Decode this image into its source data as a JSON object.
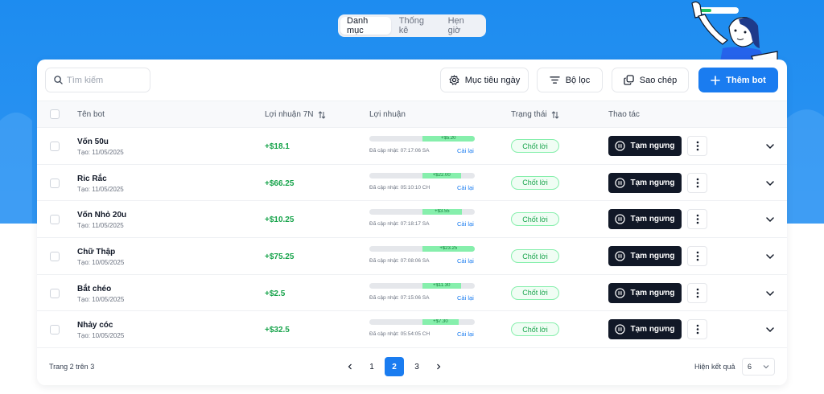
{
  "nav": {
    "tabs": [
      {
        "label": "Danh mục",
        "active": true
      },
      {
        "label": "Thống kê",
        "active": false
      },
      {
        "label": "Hẹn giờ",
        "active": false
      }
    ]
  },
  "toolbar": {
    "search_placeholder": "Tìm kiếm",
    "daily_target_label": "Mục tiêu ngày",
    "filter_label": "Bộ lọc",
    "copy_label": "Sao chép",
    "add_bot_label": "Thêm bot"
  },
  "table": {
    "columns": {
      "name": "Tên bot",
      "profit7": "Lợi nhuận 7N",
      "profit": "Lợi nhuận",
      "status": "Trạng thái",
      "actions": "Thao tác"
    },
    "rows": [
      {
        "name": "Vốn 50u",
        "created": "Tạo: 11/05/2025",
        "profit7": "+$18.1",
        "bar_label": "+$5.20",
        "bar_start": 0.5,
        "bar_end": 1.0,
        "updated": "Đã cập nhật: 07:17:06 SA",
        "reset": "Cài lại",
        "status": "Chốt lời",
        "pause": "Tạm ngưng"
      },
      {
        "name": "Ric Rắc",
        "created": "Tạo: 11/05/2025",
        "profit7": "+$66.25",
        "bar_label": "+$22.00",
        "bar_start": 0.5,
        "bar_end": 0.87,
        "updated": "Đã cập nhật: 05:10:10 CH",
        "reset": "Cài lại",
        "status": "Chốt lời",
        "pause": "Tạm ngưng"
      },
      {
        "name": "Vốn Nhỏ 20u",
        "created": "Tạo: 11/05/2025",
        "profit7": "+$10.25",
        "bar_label": "+$3.55",
        "bar_start": 0.5,
        "bar_end": 0.88,
        "updated": "Đã cập nhật: 07:18:17 SA",
        "reset": "Cài lại",
        "status": "Chốt lời",
        "pause": "Tạm ngưng"
      },
      {
        "name": "Chữ Thập",
        "created": "Tạo: 10/05/2025",
        "profit7": "+$75.25",
        "bar_label": "+$23.25",
        "bar_start": 0.5,
        "bar_end": 1.0,
        "updated": "Đã cập nhật: 07:08:06 SA",
        "reset": "Cài lại",
        "status": "Chốt lời",
        "pause": "Tạm ngưng"
      },
      {
        "name": "Bắt chéo",
        "created": "Tạo: 10/05/2025",
        "profit7": "+$2.5",
        "bar_label": "+$11.30",
        "bar_start": 0.5,
        "bar_end": 0.87,
        "updated": "Đã cập nhật: 07:15:06 SA",
        "reset": "Cài lại",
        "status": "Chốt lời",
        "pause": "Tạm ngưng"
      },
      {
        "name": "Nhảy cóc",
        "created": "Tạo: 10/05/2025",
        "profit7": "+$32.5",
        "bar_label": "+$7.30",
        "bar_start": 0.5,
        "bar_end": 0.85,
        "updated": "Đã cập nhật: 05:54:05 CH",
        "reset": "Cài lại",
        "status": "Chốt lời",
        "pause": "Tạm ngưng"
      }
    ]
  },
  "pagination": {
    "info": "Trang 2 trên 3",
    "pages": [
      "1",
      "2",
      "3"
    ],
    "current": "2",
    "per_page_label": "Hiện kết quả",
    "per_page_value": "6"
  },
  "colors": {
    "primary": "#1a7cf0",
    "success": "#16a34a",
    "dark_button": "#111827",
    "header_bg": "#1d8cf0"
  }
}
